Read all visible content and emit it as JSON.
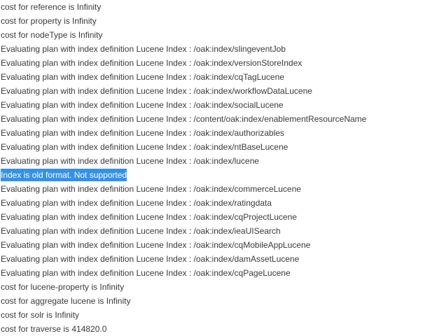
{
  "log": {
    "lines": [
      "cost for reference is Infinity",
      "cost for property is Infinity",
      "cost for nodeType is Infinity",
      "Evaluating plan with index definition Lucene Index : /oak:index/slingeventJob",
      "Evaluating plan with index definition Lucene Index : /oak:index/versionStoreIndex",
      "Evaluating plan with index definition Lucene Index : /oak:index/cqTagLucene",
      "Evaluating plan with index definition Lucene Index : /oak:index/workflowDataLucene",
      "Evaluating plan with index definition Lucene Index : /oak:index/socialLucene",
      "Evaluating plan with index definition Lucene Index : /content/oak:index/enablementResourceName",
      "Evaluating plan with index definition Lucene Index : /oak:index/authorizables",
      "Evaluating plan with index definition Lucene Index : /oak:index/ntBaseLucene",
      "Evaluating plan with index definition Lucene Index : /oak:index/lucene",
      "Index is old format. Not supported",
      "Evaluating plan with index definition Lucene Index : /oak:index/commerceLucene",
      "Evaluating plan with index definition Lucene Index : /oak:index/ratingdata",
      "Evaluating plan with index definition Lucene Index : /oak:index/cqProjectLucene",
      "Evaluating plan with index definition Lucene Index : /oak:index/ieaUISearch",
      "Evaluating plan with index definition Lucene Index : /oak:index/cqMobileAppLucene",
      "Evaluating plan with index definition Lucene Index : /oak:index/damAssetLucene",
      "Evaluating plan with index definition Lucene Index : /oak:index/cqPageLucene",
      "cost for lucene-property is Infinity",
      "cost for aggregate lucene is Infinity",
      "cost for solr is Infinity",
      "cost for traverse is 414820.0"
    ],
    "selected_line_index": 12,
    "selection_color": "#3391ea",
    "text_color": "#3a3a3a"
  }
}
